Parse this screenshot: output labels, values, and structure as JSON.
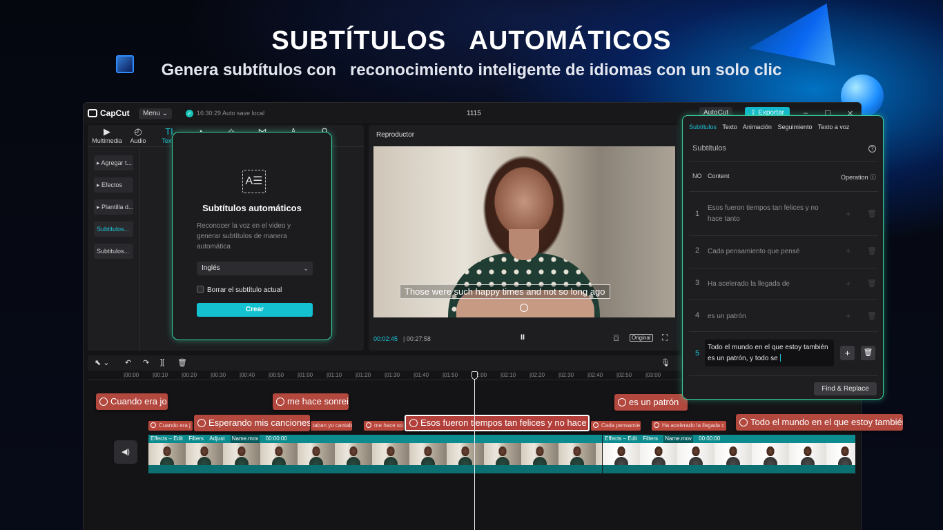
{
  "promo": {
    "title": "SUBTÍTULOS   AUTOMÁTICOS",
    "subtitle": "Genera subtítulos con   reconocimiento inteligente de idiomas con un solo clic"
  },
  "titlebar": {
    "app_name": "CapCut",
    "menu_label": "Menu",
    "autosave_text": "16:30:29 Auto save local",
    "project_title": "1115",
    "autocut_label": "AutoCut",
    "export_label": "Exportar",
    "minimize": "–",
    "maximize": "☐",
    "close": "✕"
  },
  "toolbar": {
    "tools": [
      {
        "label": "Multimedia",
        "icon": "▶"
      },
      {
        "label": "Audio",
        "icon": "◴"
      },
      {
        "label": "Texto",
        "icon": "TI"
      },
      {
        "label": "",
        "icon": "◔"
      },
      {
        "label": "",
        "icon": "✧"
      },
      {
        "label": "",
        "icon": "⋈"
      },
      {
        "label": "",
        "icon": "♙"
      },
      {
        "label": "",
        "icon": "⚲"
      }
    ]
  },
  "sidebar": {
    "items": [
      {
        "label": "▸ Agregar t..."
      },
      {
        "label": "▸ Efectos"
      },
      {
        "label": "▸ Plantilla d..."
      },
      {
        "label": "Subtitulos..."
      },
      {
        "label": "Subtitulos..."
      }
    ]
  },
  "auto_subtitle": {
    "icon_glyph": "A☰",
    "title": "Subtítulos automáticos",
    "description": "Reconocer la voz en el video y generar subtítulos de manera automática",
    "language": "Inglés",
    "clear_label": "Borrar el subtítulo actual",
    "create_label": "Crear"
  },
  "player": {
    "header": "Reproductor",
    "caption": "Those were such happy times and not so long ago",
    "current_time": "00:02:45",
    "total_time": "00:27:58",
    "pause_icon": "II",
    "screenshot_icon": "⌼",
    "original_label": "Original",
    "fullscreen_icon": "⛶"
  },
  "subtitle_panel": {
    "tabs": [
      "Subtítulos",
      "Texto",
      "Animación",
      "Seguimiento",
      "Texto a voz"
    ],
    "section_title": "Subtítulos",
    "col_no": "NO",
    "col_content": "Content",
    "col_operation": "Operation",
    "rows": [
      {
        "no": "1",
        "text": "Esos fueron tiempos tan felices y no hace tanto"
      },
      {
        "no": "2",
        "text": "Cada pensamiento que pensé"
      },
      {
        "no": "3",
        "text": "Ha acelerado la llegada de"
      },
      {
        "no": "4",
        "text": "es un patrón"
      },
      {
        "no": "5",
        "text": "Todo el mundo en el que estoy también es un patrón, y todo se"
      }
    ],
    "find_replace_label": "Find & Replace"
  },
  "timeline": {
    "tools": [
      "⬉ ⌄",
      "↶",
      "↷",
      "][",
      "🗑",
      "🎙"
    ],
    "ruler_ticks": [
      "|00:00",
      "|00:10",
      "|00:20",
      "|00:30",
      "|00:40",
      "|00:50",
      "|01:00",
      "|01:10",
      "|01:20",
      "|01:30",
      "|01:40",
      "|01:50",
      "|02:00",
      "|02:10",
      "|02:20",
      "|02:30",
      "|02:40",
      "|02:50",
      "|03:00"
    ],
    "audio_icon": "◀)",
    "big_captions": [
      {
        "text": "Cuando era jo"
      },
      {
        "text": "me hace sonreir"
      },
      {
        "text": "es un patrón"
      },
      {
        "text": "Esperando mis canciones"
      },
      {
        "text": "Esos fueron tiempos tan felices y no hace"
      },
      {
        "text": "Todo el mundo en el que estoy también"
      }
    ],
    "small_captions": [
      {
        "text": "Cuando era j"
      },
      {
        "text": "taban yo cantab"
      },
      {
        "text": "me hace so"
      },
      {
        "text": "Cada pensamie"
      },
      {
        "text": "Ha acelerado la llegada c"
      }
    ],
    "track1": {
      "effects": "Effects – Edit",
      "filters": "Filters",
      "adjust": "Adjust",
      "name": "Name.mov",
      "time": "00:00:00"
    },
    "track2": {
      "effects": "Effects – Edit",
      "filters": "Filters",
      "name": "Name.mov",
      "time": "00:00:00"
    }
  }
}
